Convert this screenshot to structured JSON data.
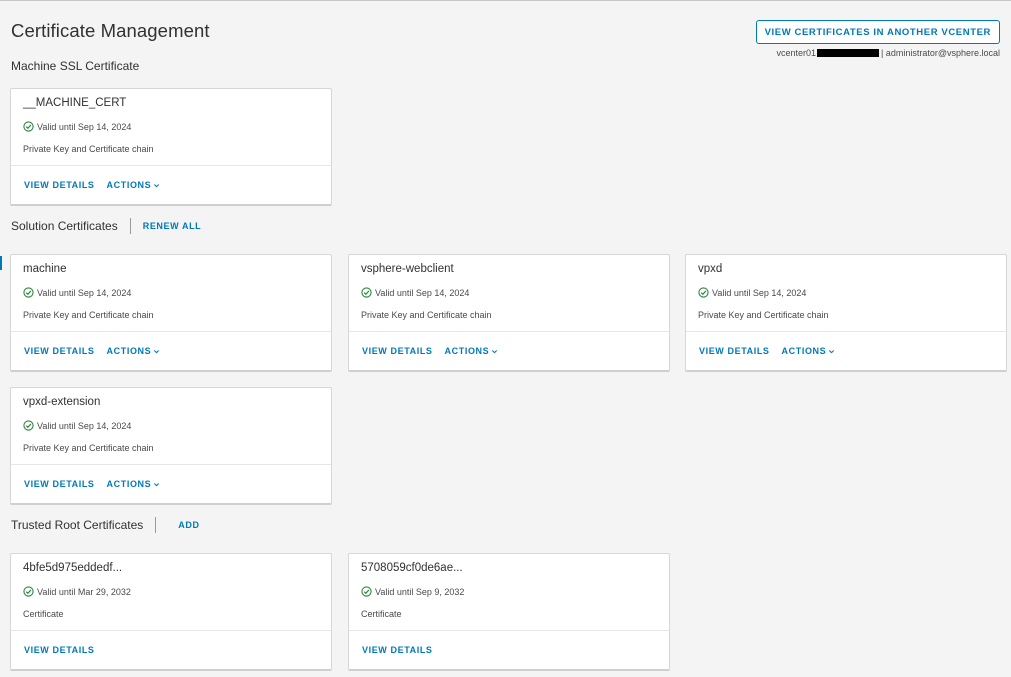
{
  "header": {
    "title": "Certificate Management",
    "vcenter_button": "VIEW CERTIFICATES IN ANOTHER VCENTER",
    "vcenter_host": "vcenter01",
    "user": "| administrator@vsphere.local"
  },
  "sections": {
    "machine_ssl": {
      "title": "Machine SSL Certificate"
    },
    "solution": {
      "title": "Solution Certificates",
      "action": "RENEW ALL"
    },
    "trusted_root": {
      "title": "Trusted Root Certificates",
      "action": "ADD"
    }
  },
  "labels": {
    "view_details": "VIEW DETAILS",
    "actions": "ACTIONS"
  },
  "cards": [
    {
      "name": "__MACHINE_CERT",
      "status": "Valid until Sep 14, 2024",
      "desc": "Private Key and Certificate chain"
    },
    {
      "name": "machine",
      "status": "Valid until Sep 14, 2024",
      "desc": "Private Key and Certificate chain"
    },
    {
      "name": "vsphere-webclient",
      "status": "Valid until Sep 14, 2024",
      "desc": "Private Key and Certificate chain"
    },
    {
      "name": "vpxd",
      "status": "Valid until Sep 14, 2024",
      "desc": "Private Key and Certificate chain"
    },
    {
      "name": "vpxd-extension",
      "status": "Valid until Sep 14, 2024",
      "desc": "Private Key and Certificate chain"
    },
    {
      "name": "4bfe5d975eddedf...",
      "status": "Valid until Mar 29, 2032",
      "desc": "Certificate"
    },
    {
      "name": "5708059cf0de6ae...",
      "status": "Valid until Sep 9, 2032",
      "desc": "Certificate"
    }
  ],
  "colors": {
    "accent": "#0079b8",
    "valid": "#2e8540"
  }
}
